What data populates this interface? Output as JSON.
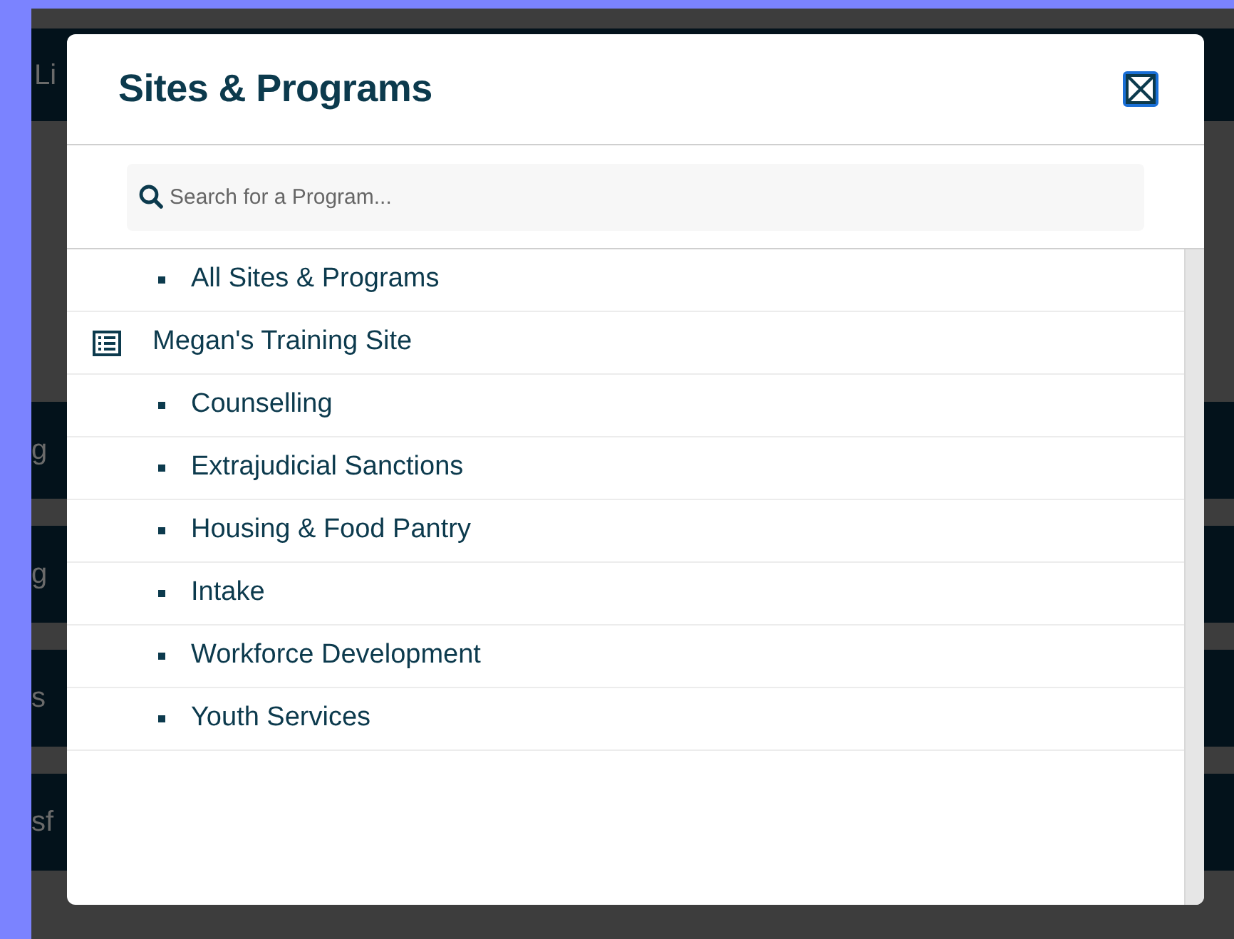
{
  "background_fragments": [
    "Li",
    "g",
    "g",
    "s",
    "sf"
  ],
  "dialog": {
    "title": "Sites & Programs",
    "search": {
      "placeholder": "Search for a Program..."
    },
    "items": [
      {
        "kind": "program",
        "label": "All Sites & Programs"
      },
      {
        "kind": "site",
        "label": "Megan's Training Site"
      },
      {
        "kind": "program",
        "label": "Counselling"
      },
      {
        "kind": "program",
        "label": "Extrajudicial Sanctions"
      },
      {
        "kind": "program",
        "label": "Housing & Food Pantry"
      },
      {
        "kind": "program",
        "label": "Intake"
      },
      {
        "kind": "program",
        "label": "Workforce Development"
      },
      {
        "kind": "program",
        "label": "Youth Services"
      }
    ]
  }
}
